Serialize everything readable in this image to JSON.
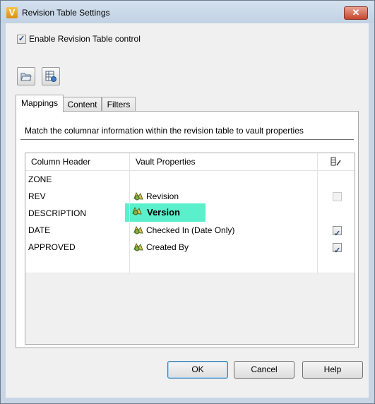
{
  "window": {
    "title": "Revision Table Settings",
    "app_icon_letter": "V",
    "close_glyph": "✕"
  },
  "enable_control": {
    "label": "Enable Revision Table control",
    "checked": true
  },
  "toolbar": {
    "buttons": [
      {
        "icon": "open-folder-icon"
      },
      {
        "icon": "table-settings-icon"
      }
    ]
  },
  "tabs": [
    {
      "label": "Mappings",
      "active": true
    },
    {
      "label": "Content",
      "active": false
    },
    {
      "label": "Filters",
      "active": false
    }
  ],
  "mappings": {
    "description": "Match the columnar information within the revision table to vault properties",
    "columns": {
      "header": "Column Header",
      "vault": "Vault Properties",
      "edit_icon": "column-edit-icon"
    },
    "rows": [
      {
        "header": "ZONE",
        "vault": "",
        "checkbox": null
      },
      {
        "header": "REV",
        "vault": "Revision",
        "checkbox": "disabled-unchecked"
      },
      {
        "header": "DESCRIPTION",
        "vault": "Version",
        "checkbox": null,
        "highlighted": true
      },
      {
        "header": "DATE",
        "vault": "Checked In (Date Only)",
        "checkbox": "checked"
      },
      {
        "header": "APPROVED",
        "vault": "Created By",
        "checkbox": "checked"
      }
    ]
  },
  "buttons": {
    "ok": "OK",
    "cancel": "Cancel",
    "help": "Help"
  },
  "colors": {
    "highlight": "#5af0cc",
    "title_bar": "#c7d5e4",
    "close_button": "#c7452d"
  }
}
